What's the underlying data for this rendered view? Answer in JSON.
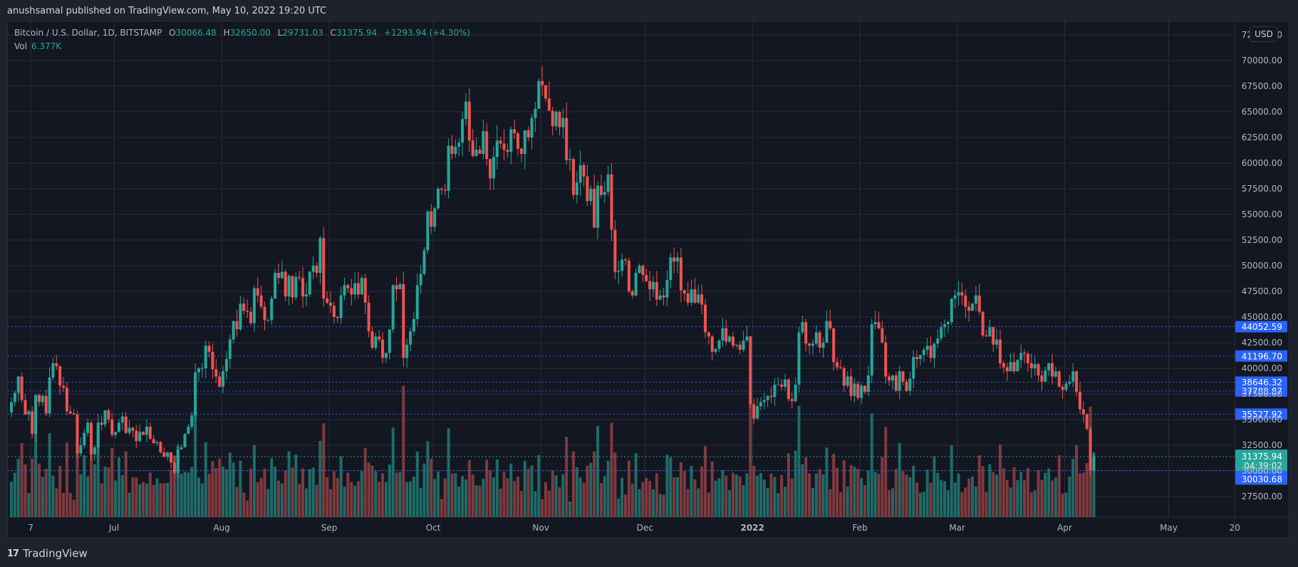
{
  "header": {
    "published": "anushsamal published on TradingView.com, May 10, 2022 19:20 UTC"
  },
  "legend": {
    "symbol": "Bitcoin / U.S. Dollar, 1D, BITSTAMP",
    "o_label": "O",
    "open": "30066.48",
    "h_label": "H",
    "high": "32650.00",
    "l_label": "L",
    "low": "29731.03",
    "c_label": "C",
    "close": "31375.94",
    "change": "+1293.94 (+4.30%)",
    "vol_label": "Vol",
    "vol_value": "6.377K"
  },
  "currency_button": "USD",
  "footer": {
    "brand": "TradingView",
    "logo": "17"
  },
  "colors": {
    "up": "#26a69a",
    "down": "#ef5350",
    "vol_up": "#1f6b67",
    "vol_down": "#7f3a3e",
    "level": "#2962ff",
    "last_price": "#26a69a"
  },
  "chart_data": {
    "type": "candlestick",
    "title": "Bitcoin / U.S. Dollar, 1D, BITSTAMP",
    "start_date": "2021-06-01",
    "end_date": "2022-05-10",
    "ylim": [
      25000,
      73000
    ],
    "y_ticks": [
      "72500.00",
      "70000.00",
      "67500.00",
      "65000.00",
      "62500.00",
      "60000.00",
      "57500.00",
      "55000.00",
      "52500.00",
      "50000.00",
      "47500.00",
      "45000.00",
      "42500.00",
      "40000.00",
      "37500.00",
      "35000.00",
      "32500.00",
      "30000.00",
      "27500.00"
    ],
    "x_ticks": [
      {
        "label": "7",
        "day": 6
      },
      {
        "label": "Jul",
        "day": 30
      },
      {
        "label": "Aug",
        "day": 61
      },
      {
        "label": "Sep",
        "day": 92
      },
      {
        "label": "Oct",
        "day": 122
      },
      {
        "label": "Nov",
        "day": 153
      },
      {
        "label": "Dec",
        "day": 183
      },
      {
        "label": "2022",
        "day": 214
      },
      {
        "label": "Feb",
        "day": 245
      },
      {
        "label": "Mar",
        "day": 273
      },
      {
        "label": "Apr",
        "day": 304
      },
      {
        "label": "May",
        "day": 334
      },
      {
        "label": "20",
        "day": 353
      }
    ],
    "grid": true,
    "price_levels": [
      {
        "value": 44052.59,
        "label": "44052.59",
        "style": "blue-dotted"
      },
      {
        "value": 41196.7,
        "label": "41196.70",
        "style": "blue-dotted"
      },
      {
        "value": 38646.32,
        "label": "38646.32",
        "style": "blue-dotted"
      },
      {
        "value": 37788.87,
        "label": "37788.87",
        "style": "blue-dotted"
      },
      {
        "value": 35527.92,
        "label": "35527.92",
        "style": "blue-dotted"
      },
      {
        "value": 30030.68,
        "label": "30030.68",
        "style": "blue-dotted"
      }
    ],
    "last_price": {
      "value": 31375.94,
      "label": "31375.94",
      "countdown": "04:39:02"
    },
    "closes": [
      36700,
      37600,
      39200,
      36900,
      35500,
      35800,
      33600,
      37400,
      36700,
      37300,
      35600,
      39100,
      40500,
      40200,
      38300,
      38100,
      35800,
      35600,
      35500,
      31700,
      32500,
      33700,
      34700,
      31600,
      32300,
      34700,
      34500,
      35900,
      35000,
      33500,
      33800,
      34700,
      35300,
      33700,
      34200,
      33900,
      32900,
      33800,
      33500,
      34300,
      33100,
      32700,
      32800,
      31800,
      31400,
      31800,
      30800,
      29800,
      32100,
      32300,
      33600,
      34300,
      35400,
      39600,
      40000,
      40000,
      42200,
      41600,
      39900,
      39200,
      38200,
      39700,
      40900,
      42800,
      44600,
      43800,
      46300,
      45600,
      45500,
      44400,
      47800,
      47100,
      46000,
      44700,
      44700,
      46800,
      49300,
      48800,
      49400,
      47000,
      49000,
      46900,
      48900,
      48800,
      47000,
      47200,
      49400,
      50000,
      49300,
      52700,
      46800,
      46400,
      46100,
      45000,
      44900,
      47100,
      48100,
      47800,
      47200,
      48300,
      47200,
      48800,
      46400,
      43600,
      42000,
      43100,
      42800,
      41000,
      41500,
      43800,
      48100,
      47700,
      48200,
      41000,
      42300,
      43600,
      44800,
      48100,
      49200,
      51500,
      55300,
      53800,
      55600,
      57500,
      57400,
      57300,
      61700,
      60900,
      61600,
      62000,
      64300,
      66000,
      62200,
      60700,
      61300,
      60900,
      63100,
      60400,
      58500,
      60600,
      62200,
      61900,
      61300,
      61100,
      63300,
      62900,
      61400,
      60900,
      63200,
      62500,
      64400,
      65300,
      68000,
      67600,
      66300,
      65100,
      63600,
      65000,
      63500,
      64400,
      60300,
      60400,
      56900,
      58100,
      59800,
      58700,
      56300,
      57500,
      53700,
      57800,
      56900,
      57200,
      58900,
      53500,
      49400,
      49500,
      50600,
      50500,
      47500,
      47100,
      49300,
      50000,
      49100,
      48500,
      47700,
      48400,
      46700,
      47100,
      46900,
      48600,
      50800,
      50400,
      50800,
      47600,
      47300,
      46400,
      47700,
      46400,
      47200,
      46200,
      43500,
      43100,
      41600,
      41900,
      42700,
      43900,
      42600,
      43100,
      42200,
      42300,
      41800,
      42700,
      43100,
      36500,
      35100,
      36300,
      36700,
      36900,
      37300,
      37200,
      38400,
      38400,
      38200,
      38900,
      37000,
      36800,
      38400,
      43500,
      44500,
      42400,
      42200,
      42400,
      43500,
      42000,
      42500,
      44600,
      43900,
      40600,
      40100,
      40000,
      38300,
      39200,
      37300,
      38500,
      37100,
      38300,
      37700,
      39300,
      44300,
      44500,
      43900,
      42500,
      39200,
      38800,
      39300,
      37800,
      39700,
      38700,
      37800,
      39000,
      41100,
      40900,
      41300,
      41800,
      42200,
      41000,
      42400,
      42900,
      44000,
      44300,
      44500,
      46800,
      47100,
      47400,
      47100,
      46000,
      45600,
      46300,
      47100,
      45500,
      43200,
      43100,
      44000,
      42300,
      42800,
      40500,
      40100,
      39700,
      40600,
      39700,
      40800,
      41500,
      41400,
      40500,
      40000,
      40400,
      39300,
      38700,
      39800,
      40500,
      39200,
      39700,
      38200,
      37900,
      38500,
      38700,
      39700,
      37700,
      36000,
      35500,
      34100,
      30066,
      31376
    ],
    "volume_note": "daily volume bars, last bar 6.377K"
  }
}
